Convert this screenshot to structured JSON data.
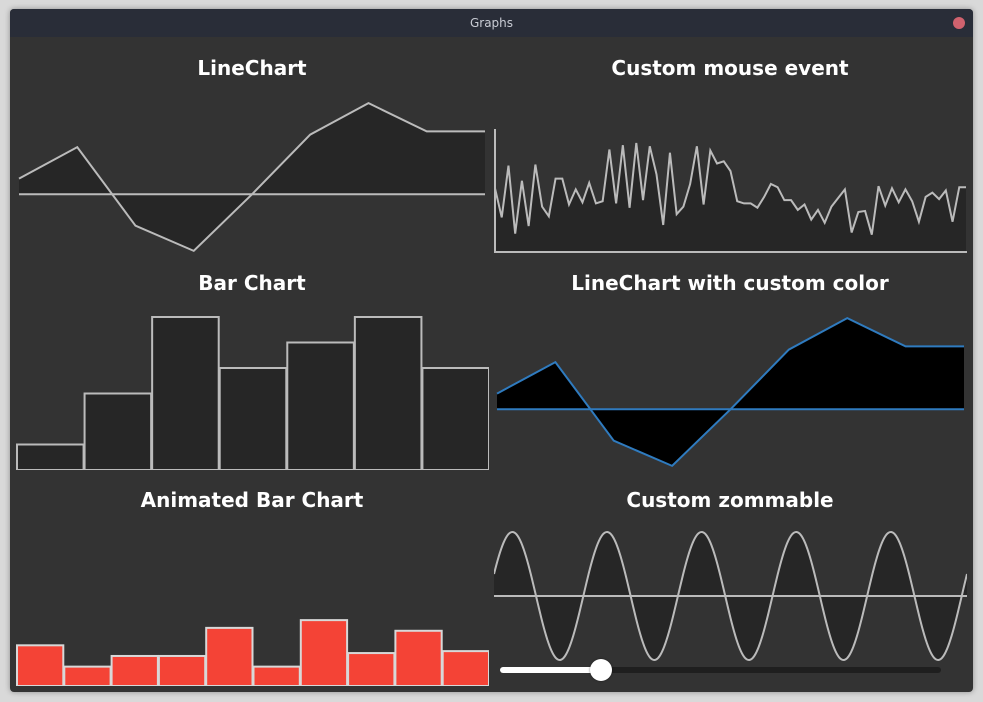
{
  "window": {
    "title": "Graphs"
  },
  "panels": {
    "line": {
      "title": "LineChart"
    },
    "mouse": {
      "title": "Custom mouse event"
    },
    "bar": {
      "title": "Bar Chart"
    },
    "colored": {
      "title": "LineChart with custom color"
    },
    "animated": {
      "title": "Animated Bar Chart"
    },
    "zoom": {
      "title": "Custom zommable"
    }
  },
  "colors": {
    "window_bg": "#333333",
    "chart_fill": "#262626",
    "chart_line": "#bbbbbb",
    "custom_line": "#2f7bbf",
    "custom_fill": "#000000",
    "bar_red": "#f44336"
  },
  "slider": {
    "value": 0.23
  },
  "chart_data": [
    {
      "type": "line",
      "values": [
        0.5,
        1.5,
        -1.0,
        -1.8,
        0.0,
        1.9,
        2.9,
        2.0,
        2.0
      ],
      "ylim": [
        -1.9,
        3.0
      ],
      "baseline": 0
    },
    {
      "type": "line",
      "values": [
        6.0,
        3.3,
        8.1,
        1.8,
        6.7,
        2.5,
        8.2,
        4.3,
        3.4,
        6.9,
        6.9,
        4.5,
        5.9,
        4.7,
        6.5,
        4.6,
        4.8,
        9.6,
        4.6,
        10.0,
        4.2,
        10.2,
        4.9,
        9.9,
        7.3,
        2.6,
        9.3,
        3.6,
        4.3,
        6.4,
        9.9,
        4.5,
        9.5,
        8.3,
        8.5,
        7.6,
        4.8,
        4.6,
        4.6,
        4.2,
        5.2,
        6.4,
        6.1,
        4.9,
        4.9,
        4.0,
        4.5,
        3.1,
        4.0,
        2.8,
        4.3,
        5.1,
        5.9,
        1.9,
        3.8,
        3.9,
        1.7,
        6.2,
        4.4,
        6.0,
        4.7,
        5.9,
        4.8,
        2.9,
        5.2,
        5.6,
        5.0,
        5.8,
        2.9,
        6.1,
        6.1
      ],
      "ylim": [
        0,
        11.5
      ]
    },
    {
      "type": "bar",
      "values": [
        1,
        3,
        6,
        4,
        5,
        6,
        4
      ],
      "ylim": [
        0,
        6
      ]
    },
    {
      "type": "line",
      "values": [
        0.5,
        1.5,
        -1.0,
        -1.8,
        0.0,
        1.9,
        2.9,
        2.0,
        2.0
      ],
      "ylim": [
        -1.9,
        3.0
      ],
      "baseline": 0
    },
    {
      "type": "bar",
      "values": [
        4.2,
        2.0,
        3.1,
        3.1,
        6.0,
        2.0,
        6.8,
        3.4,
        5.7,
        3.6
      ],
      "ylim": [
        0,
        16
      ]
    },
    {
      "type": "line",
      "function": "sin",
      "cycles": 5,
      "amplitude": 1,
      "ylim": [
        -1,
        1
      ]
    }
  ]
}
